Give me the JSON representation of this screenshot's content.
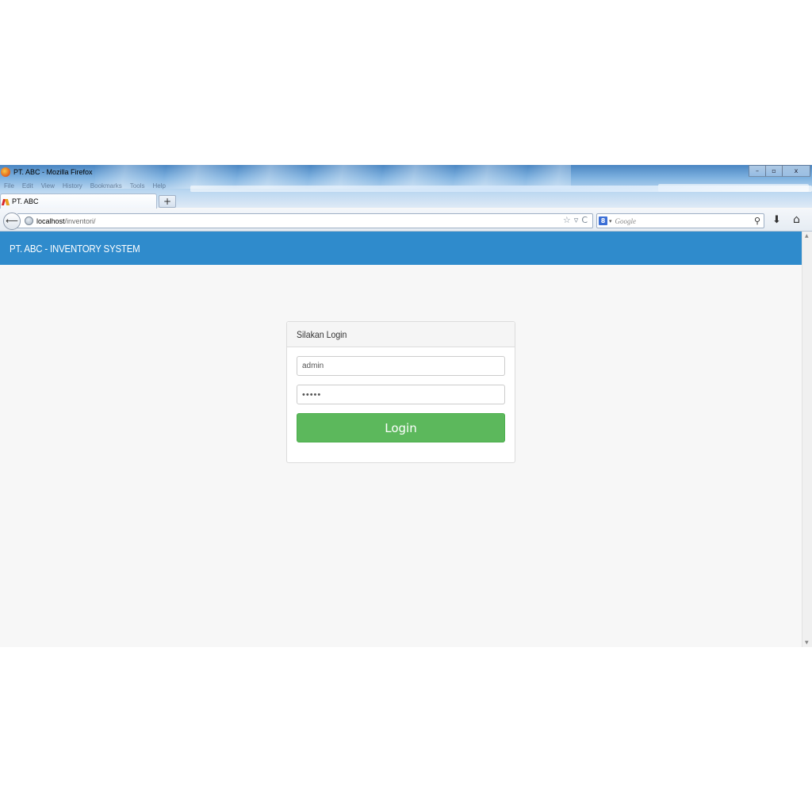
{
  "browser": {
    "window_title": "PT. ABC - Mozilla Firefox",
    "menu": [
      "File",
      "Edit",
      "View",
      "History",
      "Bookmarks",
      "Tools",
      "Help"
    ],
    "controls": {
      "minimize": "–",
      "maximize": "▫",
      "close": "x"
    },
    "tab": {
      "label": "PT. ABC",
      "new_tab": "+"
    },
    "nav": {
      "back": "⟵",
      "url_host": "localhost",
      "url_path": "/inventori/",
      "bookmark_star": "☆",
      "url_dropdown": "▿",
      "reload": "C",
      "search_engine_letter": "8",
      "search_dropdown": "▾",
      "search_placeholder": "Google",
      "search_icon": "⚲",
      "download_icon": "⬇",
      "home_icon": "⌂"
    }
  },
  "app": {
    "header_title": "PT. ABC - INVENTORY SYSTEM",
    "header_color": "#2f8bcc"
  },
  "login": {
    "panel_title": "Silakan Login",
    "username_value": "admin",
    "password_value": "•••••",
    "button_label": "Login",
    "button_color": "#5cb85c"
  },
  "scrollbar": {
    "up": "▲",
    "down": "▼"
  }
}
